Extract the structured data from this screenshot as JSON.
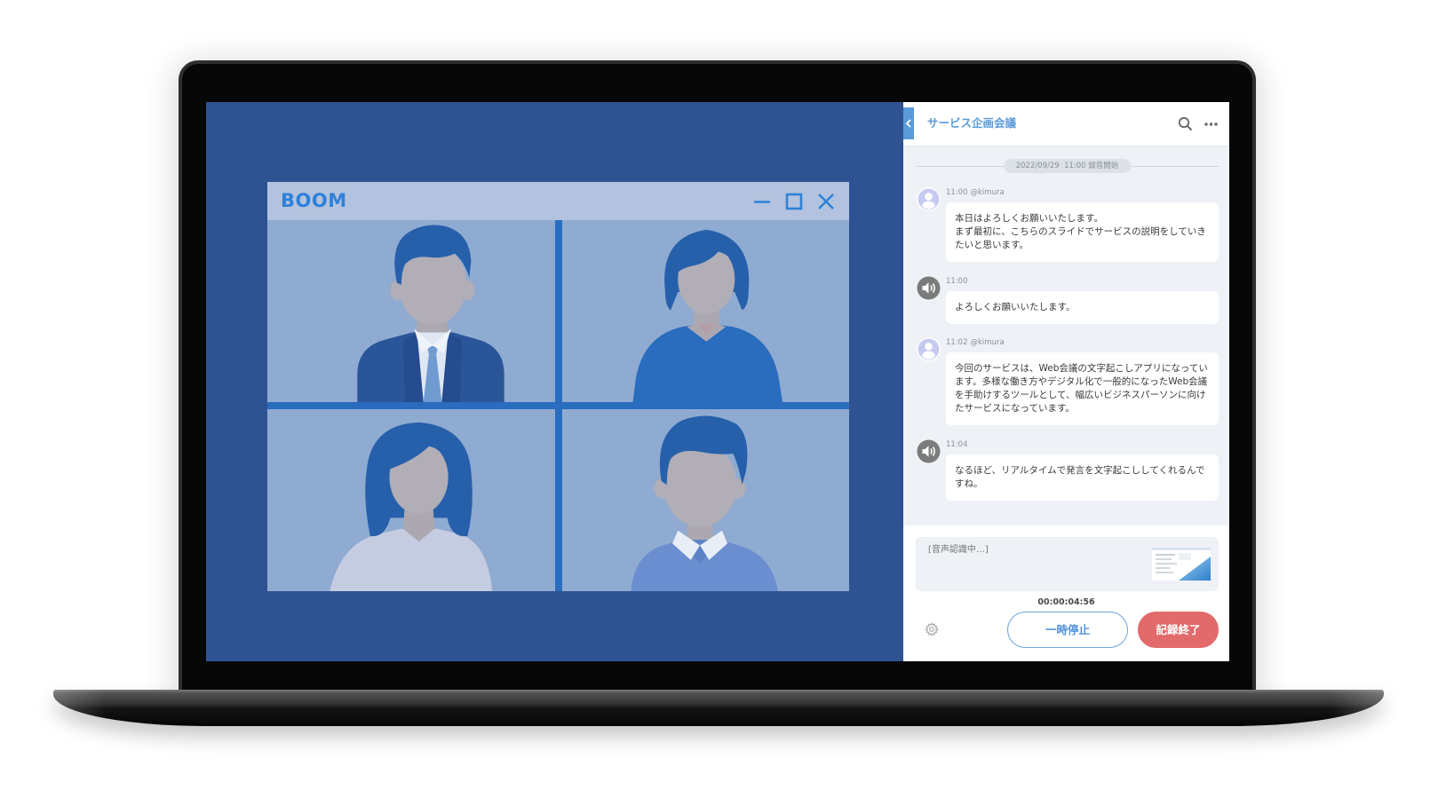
{
  "app": {
    "name": "BOOM"
  },
  "icons": {
    "window_minimize": "minimize-icon",
    "window_maximize": "maximize-icon",
    "window_close": "close-icon",
    "panel_collapse": "chevron-left-icon",
    "search": "search-icon",
    "more": "more-icon",
    "settings": "gear-icon",
    "user_avatar": "user-icon",
    "speaker_avatar": "speaker-icon"
  },
  "panel": {
    "title": "サービス企画会議",
    "divider_label": "2022/09/29  11:00 録音開始",
    "messages": [
      {
        "time": "11:00",
        "user": "@kimura",
        "avatar": "user-icon",
        "text": "本日はよろしくお願いいたします。\nまず最初に、こちらのスライドでサービスの説明をしていきたいと思います。"
      },
      {
        "time": "11:00",
        "avatar": "speaker-icon",
        "text": "よろしくお願いいたします。"
      },
      {
        "time": "11:02",
        "user": "@kimura",
        "avatar": "user-icon",
        "text": "今回のサービスは、Web会議の文字起こしアプリになっています。多様な働き方やデジタル化で一般的になったWeb会議を手助けするツールとして、幅広いビジネスパーソンに向けたサービスになっています。"
      },
      {
        "time": "11:04",
        "avatar": "speaker-icon",
        "text": "なるほど、リアルタイムで発言を文字起こししてくれるんですね。"
      }
    ],
    "recognition_status": "[音声認識中…]",
    "timer": "00:00:04:56",
    "pause_label": "一時停止",
    "stop_label": "記録終了"
  },
  "colors": {
    "video_background": "#2f5392",
    "accent": "#4f93d9",
    "stop_button": "#e26a6a",
    "chat_background": "#eef1f6"
  }
}
